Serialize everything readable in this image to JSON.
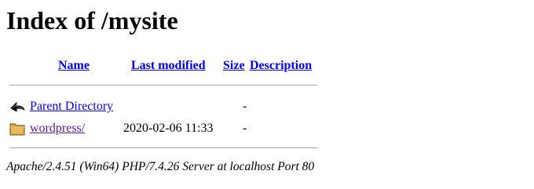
{
  "page": {
    "title": "Index of /mysite"
  },
  "table": {
    "headers": {
      "name": "Name",
      "last_modified": "Last modified",
      "size": "Size",
      "description": "Description"
    },
    "rows": [
      {
        "icon": "back-arrow-icon",
        "name": "Parent Directory",
        "last_modified": "",
        "size": "-",
        "description": ""
      },
      {
        "icon": "folder-icon",
        "name": "wordpress/",
        "last_modified": "2020-02-06 11:33",
        "size": "-",
        "description": ""
      }
    ]
  },
  "footer": {
    "address": "Apache/2.4.51 (Win64) PHP/7.4.26 Server at localhost Port 80"
  },
  "colors": {
    "link": "#0000ee",
    "visited_link": "#551a8b",
    "rule": "#a8a8a8",
    "folder": "#d9a441"
  }
}
